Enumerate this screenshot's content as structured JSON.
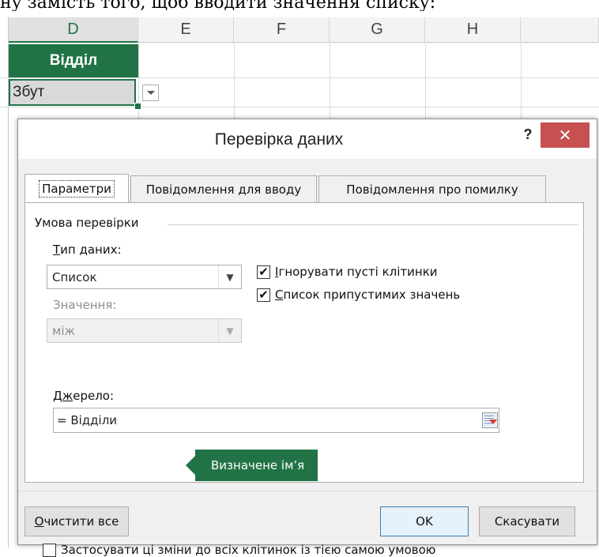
{
  "document": {
    "text_fragment": "ну замість того, щоб вводити значення списку:"
  },
  "sheet": {
    "columns": [
      "D",
      "E",
      "F",
      "G",
      "H"
    ],
    "header_cell": "Відділ",
    "active_cell_value": "Збут"
  },
  "dialog": {
    "title": "Перевірка даних",
    "help_label": "?",
    "close_label": "✕",
    "tabs": [
      {
        "label": "Параметри",
        "selected": true
      },
      {
        "label": "Повідомлення для вводу",
        "selected": false
      },
      {
        "label": "Повідомлення про помилку",
        "selected": false
      }
    ],
    "group_label": "Умова перевірки",
    "data_type_label_u": "Т",
    "data_type_label_rest": "ип даних:",
    "data_type_value": "Список",
    "values_label": "Значення:",
    "values_value": "між",
    "ignore_blank_u": "І",
    "ignore_blank_rest": "гнорувати пусті клітинки",
    "ignore_blank_checked": true,
    "incell_dropdown_u": "С",
    "incell_dropdown_rest": "писок припустимих значень",
    "incell_dropdown_checked": true,
    "source_label_pre": "Д",
    "source_label_u": "ж",
    "source_label_rest": "ерело:",
    "source_value": "= Відділи",
    "tooltip": "Визначене ім’я",
    "apply_all_label": "Застосувати ці зміни до всіх клітинок із тією самою умовою",
    "apply_all_checked": false,
    "clear_all_u": "О",
    "clear_all_rest": "чистити все",
    "ok_label": "OK",
    "cancel_label": "Скасувати"
  },
  "colors": {
    "excel_green": "#217346",
    "close_red": "#c75050"
  },
  "icons": [
    "dropdown-arrow-icon",
    "close-icon",
    "help-icon",
    "range-select-icon",
    "checkmark-icon"
  ]
}
